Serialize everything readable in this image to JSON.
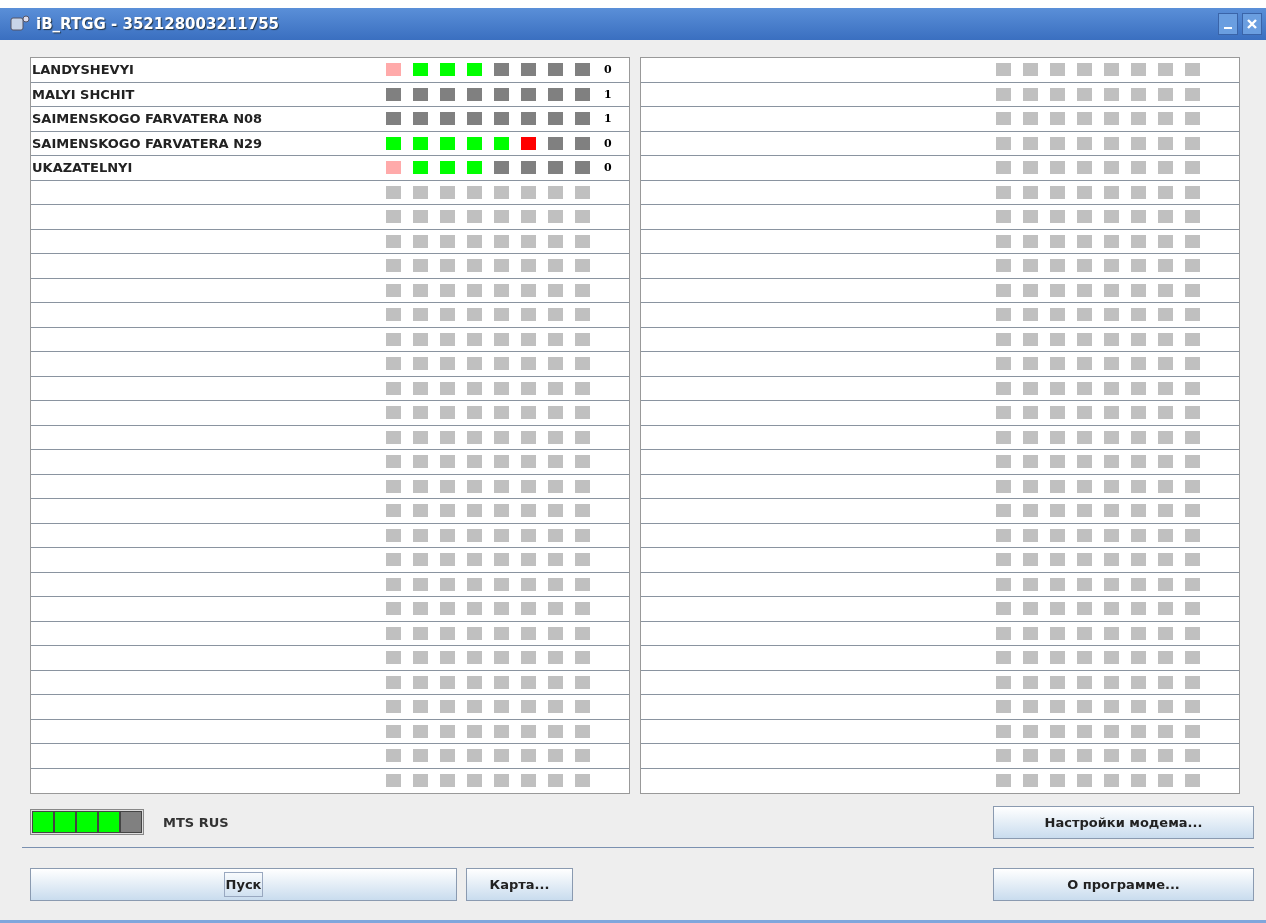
{
  "window": {
    "title": "iB_RTGG - 352128003211755"
  },
  "stations": [
    {
      "name": "LANDYSHEVYI",
      "count": "0",
      "lamps": [
        {
          "color": "#ffaaaa"
        },
        {
          "color": "#00ff00"
        },
        {
          "color": "#00ff00"
        },
        {
          "color": "#00ff00"
        },
        {
          "color": "#808080"
        },
        {
          "color": "#808080"
        },
        {
          "color": "#808080"
        },
        {
          "color": "#808080"
        }
      ]
    },
    {
      "name": "MALYI SHCHIT",
      "count": "1",
      "lamps": [
        {
          "color": "#808080"
        },
        {
          "color": "#808080"
        },
        {
          "color": "#808080"
        },
        {
          "color": "#808080"
        },
        {
          "color": "#808080"
        },
        {
          "color": "#808080"
        },
        {
          "color": "#808080"
        },
        {
          "color": "#808080"
        }
      ]
    },
    {
      "name": "SAIMENSKOGO FARVATERA N08",
      "count": "1",
      "lamps": [
        {
          "color": "#808080"
        },
        {
          "color": "#808080"
        },
        {
          "color": "#808080"
        },
        {
          "color": "#808080"
        },
        {
          "color": "#808080"
        },
        {
          "color": "#808080"
        },
        {
          "color": "#808080"
        },
        {
          "color": "#808080"
        }
      ]
    },
    {
      "name": "SAIMENSKOGO FARVATERA N29",
      "count": "0",
      "lamps": [
        {
          "color": "#00ff00"
        },
        {
          "color": "#00ff00"
        },
        {
          "color": "#00ff00"
        },
        {
          "color": "#00ff00"
        },
        {
          "color": "#00ff00"
        },
        {
          "color": "#ff0000"
        },
        {
          "color": "#808080"
        },
        {
          "color": "#808080"
        }
      ]
    },
    {
      "name": "UKAZATELNYI",
      "count": "0",
      "lamps": [
        {
          "color": "#ffaaaa"
        },
        {
          "color": "#00ff00"
        },
        {
          "color": "#00ff00"
        },
        {
          "color": "#00ff00"
        },
        {
          "color": "#808080"
        },
        {
          "color": "#808080"
        },
        {
          "color": "#808080"
        },
        {
          "color": "#808080"
        }
      ]
    }
  ],
  "signal": {
    "level": 0.8,
    "operator": "MTS RUS"
  },
  "modem_button": "Настройки модема...",
  "buttons": [
    {
      "label": "Пуск",
      "focused": true
    },
    {
      "label": "Карта..."
    }
  ],
  "about_button": "О программе..."
}
